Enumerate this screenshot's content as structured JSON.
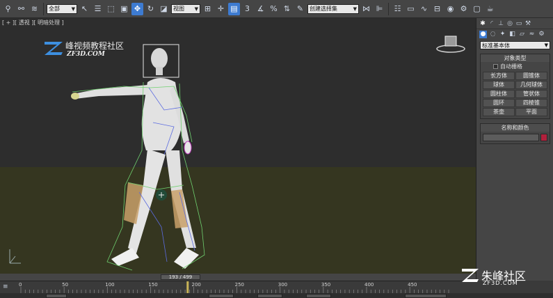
{
  "toolbar": {
    "selection_filter": "全部",
    "ref_coord": "视图",
    "named_selection": "创建选择集"
  },
  "viewport": {
    "label": "[ + ][ 透视 ][ 明暗处理 ]"
  },
  "logo": {
    "chinese": "峰视频教程社区",
    "english": "ZF3D.COM"
  },
  "watermark": {
    "chinese": "朱峰社区",
    "english": "ZF3D.COM"
  },
  "command_panel": {
    "category_select": "标准基本体",
    "object_type_title": "对象类型",
    "auto_grid_label": "自动栅格",
    "object_buttons": [
      "长方体",
      "圆锥体",
      "球体",
      "几何球体",
      "圆柱体",
      "管状体",
      "圆环",
      "四棱锥",
      "茶壶",
      "平面"
    ],
    "name_color_title": "名称和颜色",
    "object_color": "#b0203c"
  },
  "timeline": {
    "frame_display": "193 / 499",
    "current_frame": 193,
    "total_frames": 499,
    "ticks": [
      "0",
      "50",
      "100",
      "150",
      "200",
      "250",
      "300",
      "350",
      "400",
      "450"
    ]
  },
  "colors": {
    "accent": "#3d7bd1",
    "ground": "#353620",
    "sky": "#2d2d2d"
  }
}
